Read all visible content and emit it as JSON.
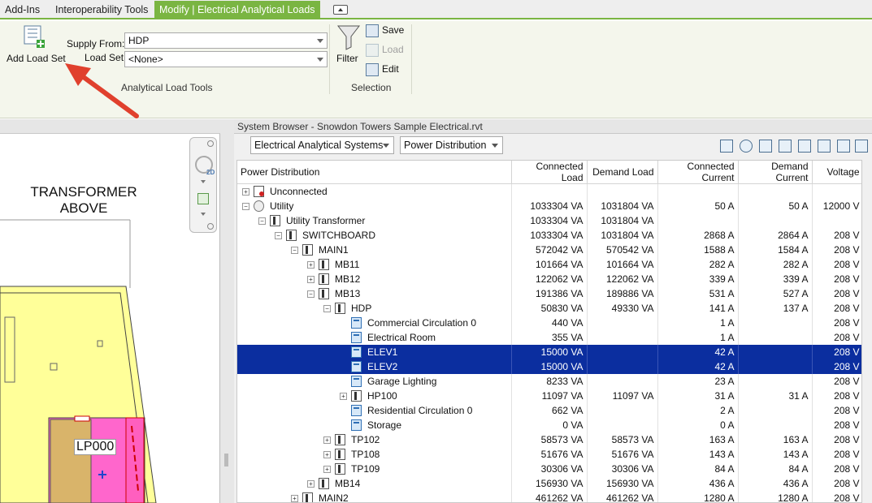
{
  "tabs": [
    "Add-Ins",
    "Interoperability Tools",
    "Modify | Electrical Analytical Loads"
  ],
  "ribbon": {
    "add_load_set": "Add Load Set",
    "supply_from_label": "Supply From:",
    "supply_from_value": "HDP",
    "load_set_label": "Load Set:",
    "load_set_value": "<None>",
    "panel1_title": "Analytical Load Tools",
    "filter": "Filter",
    "save": "Save",
    "load": "Load",
    "edit": "Edit",
    "panel2_title": "Selection"
  },
  "canvas": {
    "transformer_line1": "TRANSFORMER",
    "transformer_line2": "ABOVE",
    "panel_tag": "LP000",
    "nav_2d": "2D"
  },
  "browser": {
    "title": "System Browser - Snowdon Towers Sample Electrical.rvt",
    "systems_combo": "Electrical Analytical Systems",
    "view_combo": "Power Distribution",
    "columns": [
      "Power Distribution",
      "Connected Load",
      "Demand Load",
      "Connected Current",
      "Demand Current",
      "Voltage"
    ],
    "rows": [
      {
        "name": "Unconnected",
        "cl": "",
        "dl": "",
        "cc": "",
        "dc": "",
        "v": "",
        "level": 0,
        "exp": "+",
        "icon": "warn",
        "sel": false
      },
      {
        "name": "Utility",
        "cl": "1033304 VA",
        "dl": "1031804 VA",
        "cc": "50 A",
        "dc": "50 A",
        "v": "12000 V",
        "level": 0,
        "exp": "-",
        "icon": "util",
        "sel": false
      },
      {
        "name": "Utility Transformer",
        "cl": "1033304 VA",
        "dl": "1031804 VA",
        "cc": "",
        "dc": "",
        "v": "",
        "level": 1,
        "exp": "-",
        "icon": "panel",
        "sel": false
      },
      {
        "name": "SWITCHBOARD",
        "cl": "1033304 VA",
        "dl": "1031804 VA",
        "cc": "2868 A",
        "dc": "2864 A",
        "v": "208 V",
        "level": 2,
        "exp": "-",
        "icon": "panel",
        "sel": false
      },
      {
        "name": "MAIN1",
        "cl": "572042 VA",
        "dl": "570542 VA",
        "cc": "1588 A",
        "dc": "1584 A",
        "v": "208 V",
        "level": 3,
        "exp": "-",
        "icon": "panel",
        "sel": false
      },
      {
        "name": "MB11",
        "cl": "101664 VA",
        "dl": "101664 VA",
        "cc": "282 A",
        "dc": "282 A",
        "v": "208 V",
        "level": 4,
        "exp": "+",
        "icon": "panel",
        "sel": false
      },
      {
        "name": "MB12",
        "cl": "122062 VA",
        "dl": "122062 VA",
        "cc": "339 A",
        "dc": "339 A",
        "v": "208 V",
        "level": 4,
        "exp": "+",
        "icon": "panel",
        "sel": false
      },
      {
        "name": "MB13",
        "cl": "191386 VA",
        "dl": "189886 VA",
        "cc": "531 A",
        "dc": "527 A",
        "v": "208 V",
        "level": 4,
        "exp": "-",
        "icon": "panel",
        "sel": false
      },
      {
        "name": "HDP",
        "cl": "50830 VA",
        "dl": "49330 VA",
        "cc": "141 A",
        "dc": "137 A",
        "v": "208 V",
        "level": 5,
        "exp": "-",
        "icon": "panel",
        "sel": false
      },
      {
        "name": "Commercial Circulation 0",
        "cl": "440 VA",
        "dl": "",
        "cc": "1 A",
        "dc": "",
        "v": "208 V",
        "level": 6,
        "exp": "",
        "icon": "load",
        "sel": false
      },
      {
        "name": "Electrical Room",
        "cl": "355 VA",
        "dl": "",
        "cc": "1 A",
        "dc": "",
        "v": "208 V",
        "level": 6,
        "exp": "",
        "icon": "load",
        "sel": false
      },
      {
        "name": "ELEV1",
        "cl": "15000 VA",
        "dl": "",
        "cc": "42 A",
        "dc": "",
        "v": "208 V",
        "level": 6,
        "exp": "",
        "icon": "load",
        "sel": true
      },
      {
        "name": "ELEV2",
        "cl": "15000 VA",
        "dl": "",
        "cc": "42 A",
        "dc": "",
        "v": "208 V",
        "level": 6,
        "exp": "",
        "icon": "load",
        "sel": true
      },
      {
        "name": "Garage Lighting",
        "cl": "8233 VA",
        "dl": "",
        "cc": "23 A",
        "dc": "",
        "v": "208 V",
        "level": 6,
        "exp": "",
        "icon": "load",
        "sel": false
      },
      {
        "name": "HP100",
        "cl": "11097 VA",
        "dl": "11097 VA",
        "cc": "31 A",
        "dc": "31 A",
        "v": "208 V",
        "level": 6,
        "exp": "+",
        "icon": "panel",
        "sel": false
      },
      {
        "name": "Residential Circulation 0",
        "cl": "662 VA",
        "dl": "",
        "cc": "2 A",
        "dc": "",
        "v": "208 V",
        "level": 6,
        "exp": "",
        "icon": "load",
        "sel": false
      },
      {
        "name": "Storage",
        "cl": "0 VA",
        "dl": "",
        "cc": "0 A",
        "dc": "",
        "v": "208 V",
        "level": 6,
        "exp": "",
        "icon": "load",
        "sel": false
      },
      {
        "name": "TP102",
        "cl": "58573 VA",
        "dl": "58573 VA",
        "cc": "163 A",
        "dc": "163 A",
        "v": "208 V",
        "level": 5,
        "exp": "+",
        "icon": "panel",
        "sel": false
      },
      {
        "name": "TP108",
        "cl": "51676 VA",
        "dl": "51676 VA",
        "cc": "143 A",
        "dc": "143 A",
        "v": "208 V",
        "level": 5,
        "exp": "+",
        "icon": "panel",
        "sel": false
      },
      {
        "name": "TP109",
        "cl": "30306 VA",
        "dl": "30306 VA",
        "cc": "84 A",
        "dc": "84 A",
        "v": "208 V",
        "level": 5,
        "exp": "+",
        "icon": "panel",
        "sel": false
      },
      {
        "name": "MB14",
        "cl": "156930 VA",
        "dl": "156930 VA",
        "cc": "436 A",
        "dc": "436 A",
        "v": "208 V",
        "level": 4,
        "exp": "+",
        "icon": "panel",
        "sel": false
      },
      {
        "name": "MAIN2",
        "cl": "461262 VA",
        "dl": "461262 VA",
        "cc": "1280 A",
        "dc": "1280 A",
        "v": "208 V",
        "level": 3,
        "exp": "+",
        "icon": "panel",
        "sel": false
      }
    ]
  },
  "colors": {
    "accent_green": "#7ab542",
    "selection_blue": "#0b2e9f",
    "plan_yellow": "#ffff99",
    "plan_pink": "#ff66cc",
    "arrow_red": "#e0402d"
  }
}
